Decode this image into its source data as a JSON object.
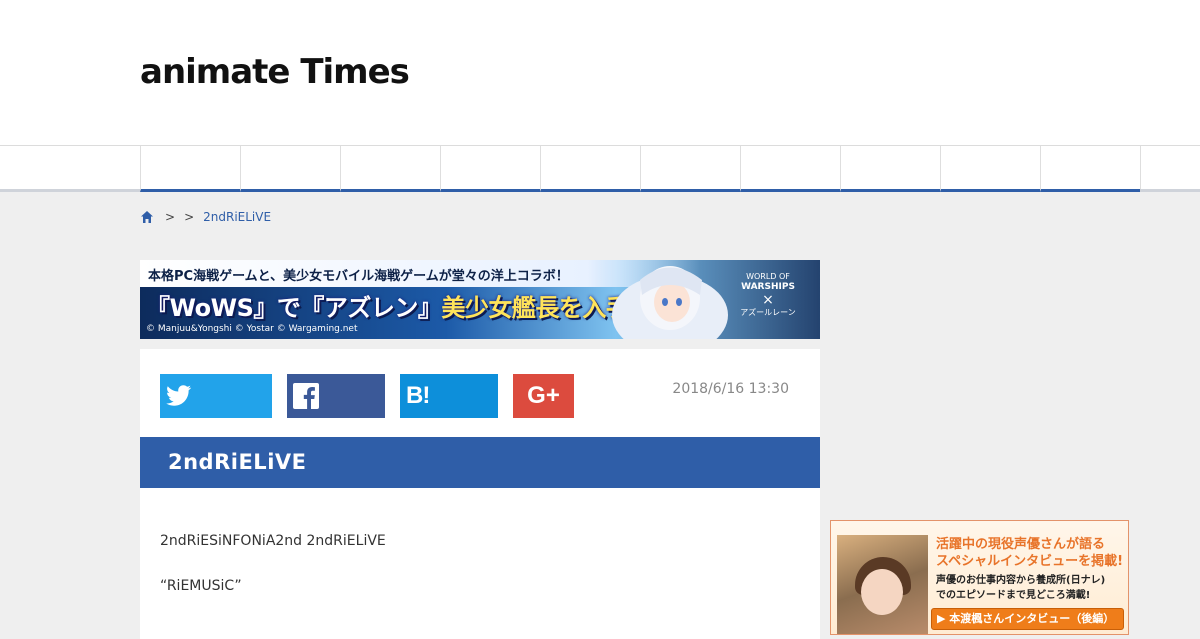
{
  "site": {
    "logo_text": "animate Times",
    "accent_color": "#2f5ea8"
  },
  "nav": {
    "item_count": 10
  },
  "breadcrumb": {
    "home_icon": "home-icon",
    "sep1": ">",
    "sep2": ">",
    "current": "2ndRiELiVE"
  },
  "banner": {
    "line1": "本格PC海戦ゲームと、美少女モバイル海戦ゲームが堂々の洋上コラボ！",
    "line2_a": "『WoWS』で『アズレン』",
    "line2_b": "美少女艦長を入手せよ！",
    "copyright": "© Manjuu&Yongshi © Yostar © Wargaming.net",
    "logo_line1": "WORLD OF",
    "logo_line2": "WARSHIPS",
    "logo_x": "×",
    "logo_line3": "アズールレーン"
  },
  "share": {
    "twitter_icon": "twitter-icon",
    "facebook_icon": "facebook-icon",
    "hatena_icon": "hatena-bookmark-icon",
    "gplus_icon": "google-plus-icon",
    "hatena_label": "B!",
    "gplus_label": "G+"
  },
  "article": {
    "date": "2018/6/16 13:30",
    "title": "2ndRiELiVE",
    "paragraph1": "2ndRiESiNFONiA2nd 2ndRiELiVE",
    "paragraph2": "“RiEMUSiC”"
  },
  "sidebar_ad": {
    "headline1": "活躍中の現役声優さんが語る",
    "headline2": "スペシャルインタビューを掲載!",
    "sub1": "声優のお仕事内容から養成所(日ナレ)",
    "sub2": "でのエピソードまで見どころ満載!",
    "button": "▶ 本渡楓さんインタビュー（後編）"
  }
}
